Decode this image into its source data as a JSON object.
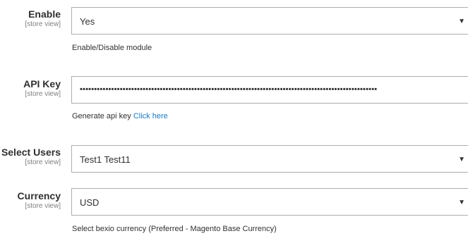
{
  "fields": {
    "enable": {
      "label": "Enable",
      "scope": "[store view]",
      "value": "Yes",
      "note": "Enable/Disable module"
    },
    "api_key": {
      "label": "API Key",
      "scope": "[store view]",
      "value": "••••••••••••••••••••••••••••••••••••••••••••••••••••••••••••••••••••••••••••••••••••••••••••••••••••••••",
      "note_prefix": "Generate api key ",
      "note_link": "Click here"
    },
    "select_users": {
      "label": "Select Users",
      "scope": "[store view]",
      "value": "Test1 Test11"
    },
    "currency": {
      "label": "Currency",
      "scope": "[store view]",
      "value": "USD",
      "note": "Select bexio currency (Preferred - Magento Base Currency)"
    }
  },
  "icons": {
    "dropdown": "triangle-down"
  },
  "colors": {
    "link": "#1979c3",
    "border": "#adadad",
    "scope": "#808080"
  }
}
